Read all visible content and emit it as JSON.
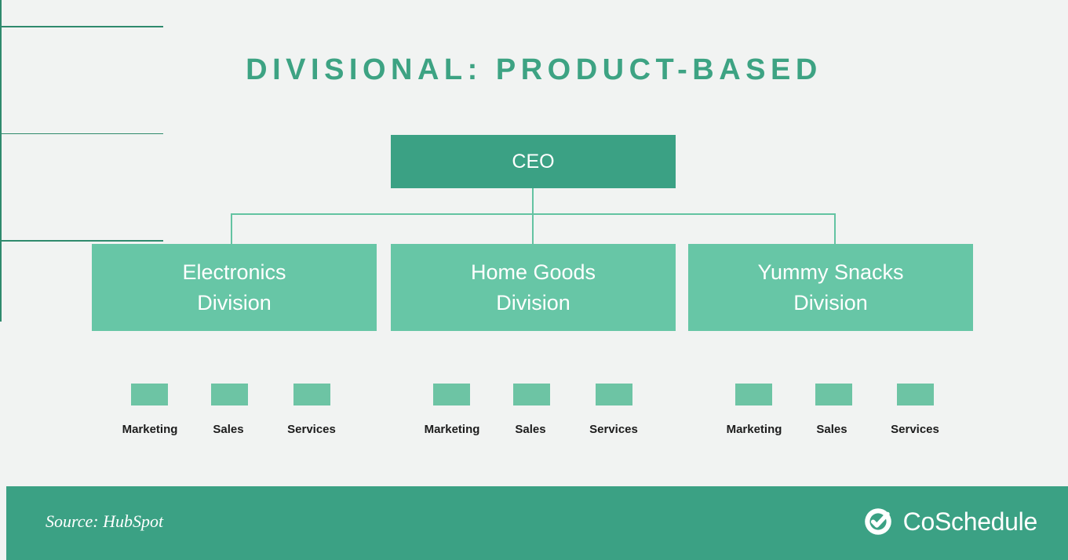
{
  "title": "DIVISIONAL: PRODUCT-BASED",
  "colors": {
    "background": "#f1f3f2",
    "title": "#3da383",
    "root_box": "#3ba184",
    "division_box": "#67c6a6",
    "leaf_box": "#6dc4a4",
    "connector": "#63c3a2",
    "connector_thin": "#2f8a6d",
    "footer": "#3ba184",
    "box_text": "#ffffff",
    "leaf_label_text": "#1c1c1c"
  },
  "chart": {
    "root": {
      "label": "CEO"
    },
    "divisions": [
      {
        "label": "Electronics\nDivision",
        "line1": "Electronics",
        "line2": "Division",
        "children": [
          {
            "label": "Marketing"
          },
          {
            "label": "Sales"
          },
          {
            "label": "Services"
          }
        ]
      },
      {
        "label": "Home Goods\nDivision",
        "line1": "Home Goods",
        "line2": "Division",
        "children": [
          {
            "label": "Marketing"
          },
          {
            "label": "Sales"
          },
          {
            "label": "Services"
          }
        ]
      },
      {
        "label": "Yummy Snacks\nDivision",
        "line1": "Yummy Snacks",
        "line2": "Division",
        "children": [
          {
            "label": "Marketing"
          },
          {
            "label": "Sales"
          },
          {
            "label": "Services"
          }
        ]
      }
    ]
  },
  "footer": {
    "source": "Source: HubSpot",
    "logo_text": "CoSchedule",
    "logo_icon": "coschedule-check-circle-icon"
  }
}
